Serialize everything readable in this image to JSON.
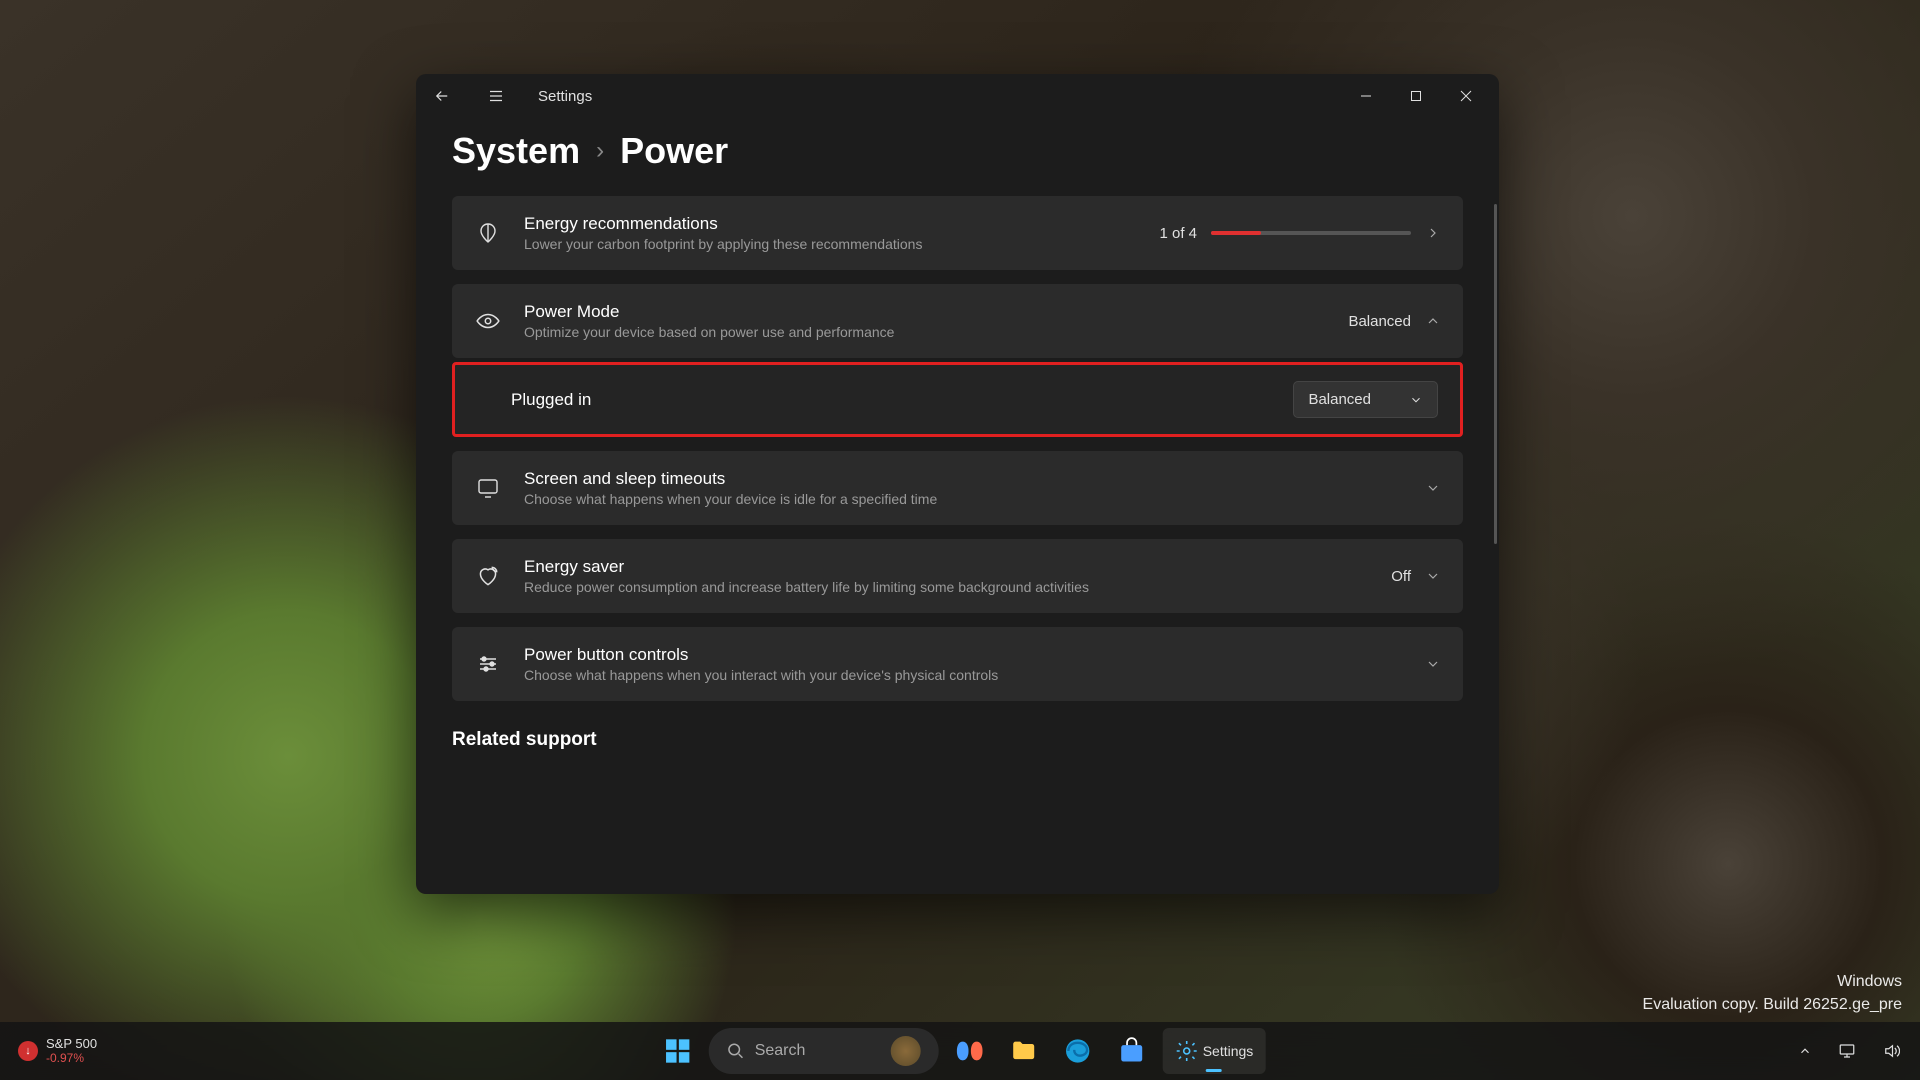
{
  "app": {
    "title": "Settings"
  },
  "breadcrumb": {
    "parent": "System",
    "current": "Power"
  },
  "cards": {
    "energy_rec": {
      "title": "Energy recommendations",
      "sub": "Lower your carbon footprint by applying these recommendations",
      "progress_text": "1 of 4",
      "progress_pct": 25
    },
    "power_mode": {
      "title": "Power Mode",
      "sub": "Optimize your device based on power use and performance",
      "value": "Balanced"
    },
    "plugged_in": {
      "label": "Plugged in",
      "dropdown_value": "Balanced"
    },
    "screen_sleep": {
      "title": "Screen and sleep timeouts",
      "sub": "Choose what happens when your device is idle for a specified time"
    },
    "energy_saver": {
      "title": "Energy saver",
      "sub": "Reduce power consumption and increase battery life by limiting some background activities",
      "value": "Off"
    },
    "power_button": {
      "title": "Power button controls",
      "sub": "Choose what happens when you interact with your device's physical controls"
    }
  },
  "related_support": "Related support",
  "watermark": {
    "line1": "Windows",
    "line2": "Evaluation copy. Build 26252.ge_pre"
  },
  "taskbar": {
    "stock": {
      "name": "S&P 500",
      "change": "-0.97%"
    },
    "search_placeholder": "Search",
    "settings_label": "Settings"
  }
}
